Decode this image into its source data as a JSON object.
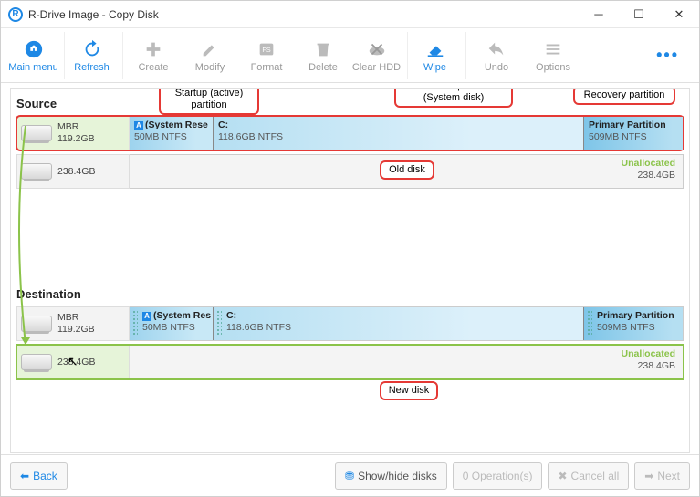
{
  "window": {
    "title": "R-Drive Image - Copy Disk"
  },
  "toolbar": {
    "mainmenu": "Main menu",
    "refresh": "Refresh",
    "create": "Create",
    "modify": "Modify",
    "format": "Format",
    "delete": "Delete",
    "clearhdd": "Clear HDD",
    "wipe": "Wipe",
    "undo": "Undo",
    "options": "Options"
  },
  "sections": {
    "source": "Source",
    "destination": "Destination"
  },
  "source": {
    "disk1": {
      "scheme": "MBR",
      "size": "119.2GB",
      "p1": {
        "name": "(System Rese",
        "size": "50MB NTFS"
      },
      "p2": {
        "name": "C:",
        "size": "118.6GB NTFS"
      },
      "p3": {
        "name": "Primary Partition",
        "size": "509MB NTFS"
      }
    },
    "disk2": {
      "size": "238.4GB",
      "un_name": "Unallocated",
      "un_size": "238.4GB"
    }
  },
  "dest": {
    "disk1": {
      "scheme": "MBR",
      "size": "119.2GB",
      "p1": {
        "name": "(System Res",
        "size": "50MB NTFS"
      },
      "p2": {
        "name": "C:",
        "size": "118.6GB NTFS"
      },
      "p3": {
        "name": "Primary Partition",
        "size": "509MB NTFS"
      }
    },
    "disk2": {
      "size": "238.4GB",
      "un_name": "Unallocated",
      "un_size": "238.4GB"
    }
  },
  "annotations": {
    "startup": "Startup (active) partition",
    "windows": "Windows partition (System disk)",
    "recovery": "Recovery partition",
    "olddisk": "Old disk",
    "newdisk": "New disk"
  },
  "footer": {
    "back": "Back",
    "showhide": "Show/hide disks",
    "ops": "0 Operation(s)",
    "cancel": "Cancel all",
    "next": "Next"
  }
}
